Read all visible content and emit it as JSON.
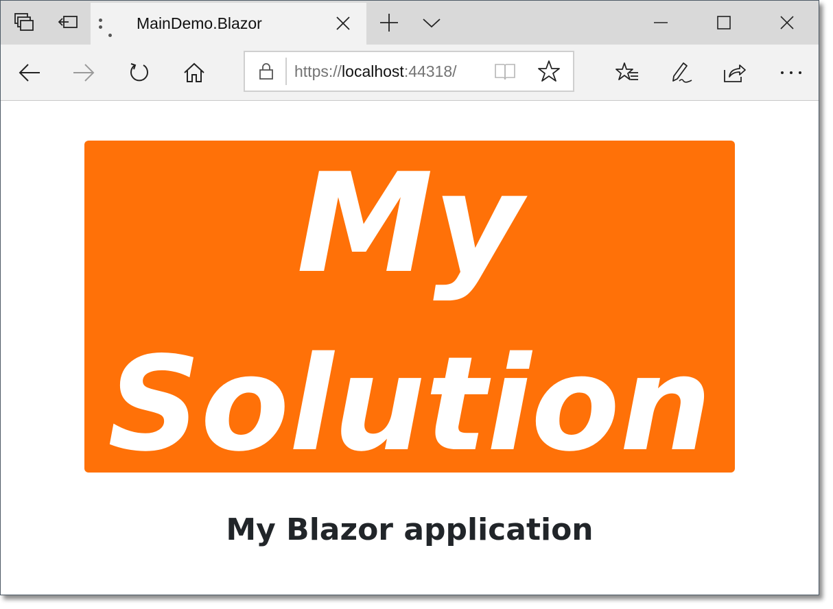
{
  "browser": {
    "tab": {
      "title": "MainDemo.Blazor"
    },
    "address_bar": {
      "url_scheme": "https://",
      "url_host": "localhost",
      "url_rest": ":44318/"
    }
  },
  "page": {
    "logo": {
      "line1": "My",
      "line2": "Solution",
      "background_color": "#ff7108"
    },
    "heading": "My Blazor application"
  },
  "icons": {
    "set_tabs_aside": "set-tabs-aside-icon",
    "show_tabs_aside": "tabs-aside-icon",
    "new_tab": "plus-icon",
    "tab_preview": "chevron-down-icon",
    "minimize": "minimize-icon",
    "maximize": "maximize-icon",
    "close": "close-icon",
    "back": "back-arrow-icon",
    "forward": "forward-arrow-icon",
    "refresh": "refresh-icon",
    "home": "home-icon",
    "lock": "lock-icon",
    "reading_view": "book-icon",
    "favorite": "star-icon",
    "favorites_hub": "favorites-list-icon",
    "web_note": "pen-icon",
    "share": "share-icon",
    "more": "more-dots-icon"
  }
}
